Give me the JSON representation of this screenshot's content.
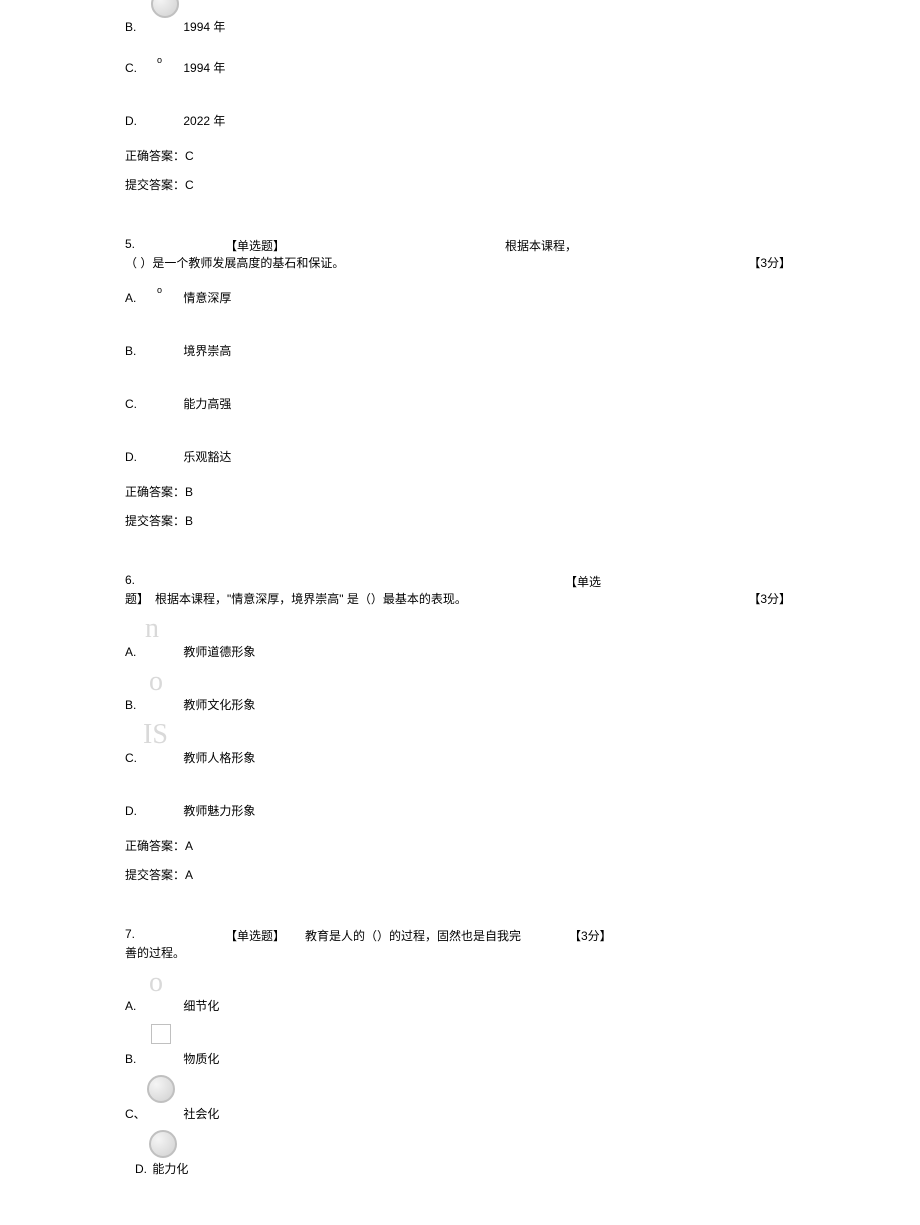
{
  "q4_tail": {
    "options": [
      {
        "label": "B.",
        "text": "1994 年",
        "wm": "circle"
      },
      {
        "label": "C.",
        "text": "1994 年",
        "sup": "o"
      },
      {
        "label": "D.",
        "text": "2022 年"
      }
    ],
    "correct_label": "正确答案：",
    "correct_value": "C",
    "submit_label": "提交答案：",
    "submit_value": "C"
  },
  "q5": {
    "num": "5.",
    "type": "【单选题】",
    "stem_pre": "根据本课程，",
    "stem": "（ ）是一个教师发展高度的基石和保证。",
    "score": "【3分】",
    "options": [
      {
        "label": "A.",
        "text": "情意深厚",
        "sup": "o"
      },
      {
        "label": "B.",
        "text": "境界崇高"
      },
      {
        "label": "C.",
        "text": "能力高强"
      },
      {
        "label": "D.",
        "text": "乐观豁达"
      }
    ],
    "correct_label": "正确答案：",
    "correct_value": "B",
    "submit_label": "提交答案：",
    "submit_value": "B"
  },
  "q6": {
    "num": "6.",
    "type": "【单选",
    "type2": "题】",
    "stem": "根据本课程，\"情意深厚，境界崇高\" 是（）最基本的表现。",
    "score": "【3分】",
    "options": [
      {
        "label": "A.",
        "text": "教师道德形象",
        "wm_text": "n"
      },
      {
        "label": "B.",
        "text": "教师文化形象",
        "wm_text": "o"
      },
      {
        "label": "C.",
        "text": "教师人格形象",
        "wm_text": "IS"
      },
      {
        "label": "D.",
        "text": "教师魅力形象"
      }
    ],
    "correct_label": "正确答案：",
    "correct_value": "A",
    "submit_label": "提交答案：",
    "submit_value": "A"
  },
  "q7": {
    "num": "7.",
    "type": "【单选题】",
    "stem_mid": "教育是人的（）的过程，固然也是自我完",
    "stem_wrap": "善的过程。",
    "score": "【3分】",
    "options": [
      {
        "label": "A.",
        "text": "细节化",
        "wm_text": "o"
      },
      {
        "label": "B.",
        "text": "物质化",
        "wm": "square"
      },
      {
        "label": "C、",
        "text": "社会化",
        "wm": "circle"
      },
      {
        "label": "D.",
        "text": "能力化",
        "wm": "circle",
        "inline": true
      }
    ]
  }
}
